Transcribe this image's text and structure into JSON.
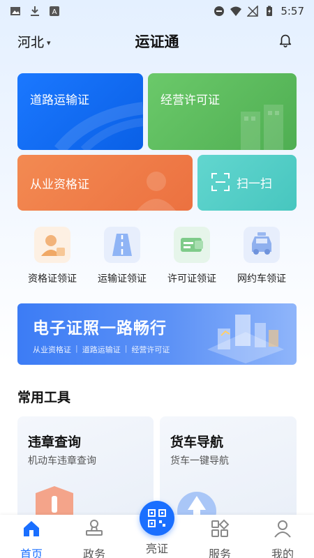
{
  "status_bar": {
    "time": "5:57"
  },
  "header": {
    "region": "河北",
    "title": "运证通"
  },
  "cards": {
    "road_transport": "道路运输证",
    "business_permit": "经营许可证",
    "qualification": "从业资格证",
    "scan": "扫一扫"
  },
  "quick_actions": [
    {
      "label": "资格证领证",
      "icon": "person-card-icon"
    },
    {
      "label": "运输证领证",
      "icon": "road-icon"
    },
    {
      "label": "许可证领证",
      "icon": "license-card-icon"
    },
    {
      "label": "网约车领证",
      "icon": "taxi-icon"
    }
  ],
  "banner": {
    "title": "电子证照一路畅行",
    "tags": [
      "从业资格证",
      "道路运输证",
      "经营许可证"
    ]
  },
  "tools_section": {
    "title": "常用工具",
    "items": [
      {
        "title": "违章查询",
        "subtitle": "机动车违章查询"
      },
      {
        "title": "货车导航",
        "subtitle": "货车一键导航"
      }
    ]
  },
  "tabbar": {
    "items": [
      "首页",
      "政务",
      "亮证",
      "服务",
      "我的"
    ],
    "active": "首页"
  },
  "colors": {
    "accent": "#1a6fff",
    "road_card": "#1b78ff",
    "biz_card": "#5cbc5e",
    "qual_card": "#f07c48",
    "scan_card": "#55cec7"
  }
}
